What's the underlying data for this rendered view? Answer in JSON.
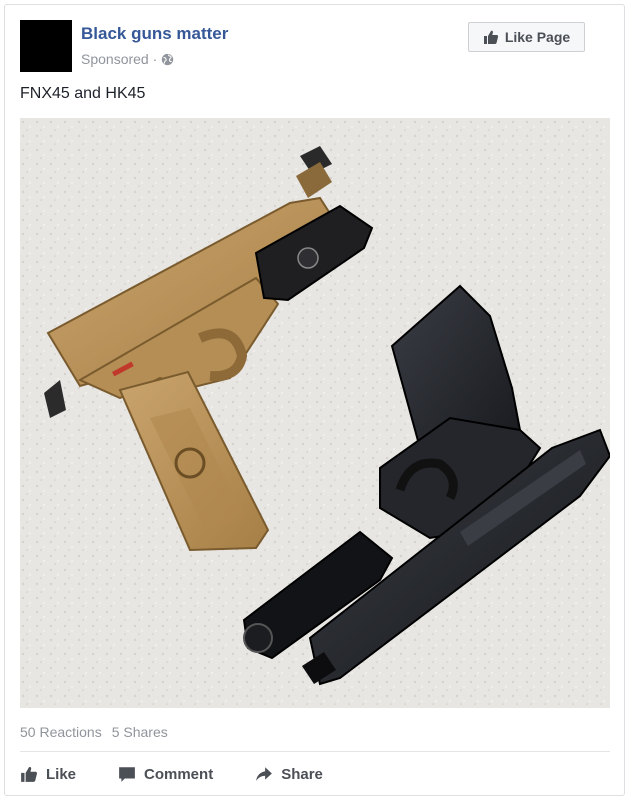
{
  "post": {
    "page_name": "Black guns matter",
    "sponsored_label": "Sponsored ·",
    "like_page_label": "Like Page",
    "text": "FNX45 and HK45",
    "photo_description_icon": "photo"
  },
  "stats": {
    "reactions": "50 Reactions",
    "shares": "5 Shares"
  },
  "actions": {
    "like": "Like",
    "comment": "Comment",
    "share": "Share"
  },
  "colors": {
    "link_blue": "#365899",
    "meta_gray": "#90949c",
    "action_gray": "#4b4f56"
  },
  "icons": [
    "globe-icon",
    "thumbs-up-icon",
    "comment-icon",
    "share-icon"
  ]
}
